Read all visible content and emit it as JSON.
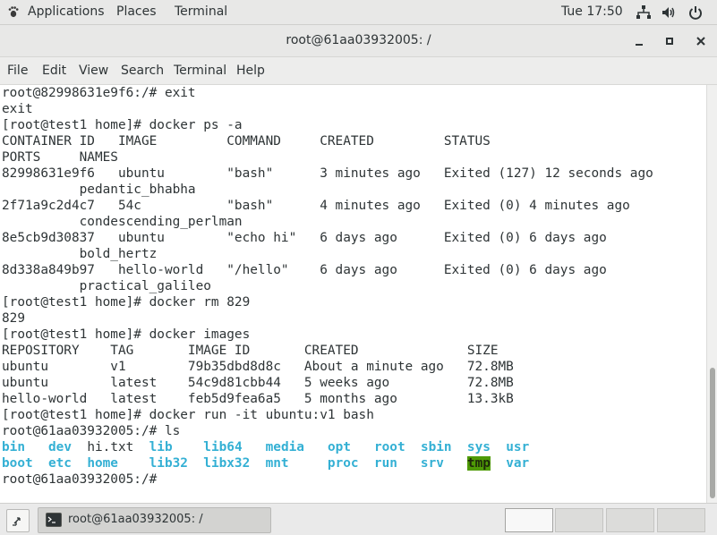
{
  "top_bar": {
    "applications_label": "Applications",
    "places_label": "Places",
    "terminal_label": "Terminal",
    "clock": "Tue 17:50"
  },
  "window": {
    "title": "root@61aa03932005: /",
    "menu": [
      "File",
      "Edit",
      "View",
      "Search",
      "Terminal",
      "Help"
    ]
  },
  "terminal": {
    "lines": [
      "root@82998631e9f6:/# exit",
      "exit",
      "[root@test1 home]# docker ps -a",
      "CONTAINER ID   IMAGE         COMMAND     CREATED         STATUS",
      "PORTS     NAMES",
      "82998631e9f6   ubuntu        \"bash\"      3 minutes ago   Exited (127) 12 seconds ago",
      "          pedantic_bhabha",
      "2f71a9c2d4c7   54c           \"bash\"      4 minutes ago   Exited (0) 4 minutes ago",
      "          condescending_perlman",
      "8e5cb9d30837   ubuntu        \"echo hi\"   6 days ago      Exited (0) 6 days ago",
      "          bold_hertz",
      "8d338a849b97   hello-world   \"/hello\"    6 days ago      Exited (0) 6 days ago",
      "          practical_galileo",
      "[root@test1 home]# docker rm 829",
      "829",
      "[root@test1 home]# docker images",
      "REPOSITORY    TAG       IMAGE ID       CREATED              SIZE",
      "ubuntu        v1        79b35dbd8d8c   About a minute ago   72.8MB",
      "ubuntu        latest    54c9d81cbb44   5 weeks ago          72.8MB",
      "hello-world   latest    feb5d9fea6a5   5 months ago         13.3kB",
      "[root@test1 home]# docker run -it ubuntu:v1 bash",
      "root@61aa03932005:/# ls"
    ],
    "ls_row1": [
      {
        "t": "bin",
        "s": "dir"
      },
      {
        "t": "   ",
        "s": ""
      },
      {
        "t": "dev",
        "s": "dir"
      },
      {
        "t": "  ",
        "s": ""
      },
      {
        "t": "hi.txt",
        "s": ""
      },
      {
        "t": "  ",
        "s": ""
      },
      {
        "t": "lib",
        "s": "dir"
      },
      {
        "t": "    ",
        "s": ""
      },
      {
        "t": "lib64",
        "s": "dir"
      },
      {
        "t": "   ",
        "s": ""
      },
      {
        "t": "media",
        "s": "dir"
      },
      {
        "t": "   ",
        "s": ""
      },
      {
        "t": "opt",
        "s": "dir"
      },
      {
        "t": "   ",
        "s": ""
      },
      {
        "t": "root",
        "s": "dir"
      },
      {
        "t": "  ",
        "s": ""
      },
      {
        "t": "sbin",
        "s": "dir"
      },
      {
        "t": "  ",
        "s": ""
      },
      {
        "t": "sys",
        "s": "dir"
      },
      {
        "t": "  ",
        "s": ""
      },
      {
        "t": "usr",
        "s": "dir"
      }
    ],
    "ls_row2": [
      {
        "t": "boot",
        "s": "dir"
      },
      {
        "t": "  ",
        "s": ""
      },
      {
        "t": "etc",
        "s": "dir"
      },
      {
        "t": "  ",
        "s": ""
      },
      {
        "t": "home",
        "s": "dir"
      },
      {
        "t": "    ",
        "s": ""
      },
      {
        "t": "lib32",
        "s": "dir"
      },
      {
        "t": "  ",
        "s": ""
      },
      {
        "t": "libx32",
        "s": "dir"
      },
      {
        "t": "  ",
        "s": ""
      },
      {
        "t": "mnt",
        "s": "dir"
      },
      {
        "t": "     ",
        "s": ""
      },
      {
        "t": "proc",
        "s": "dir"
      },
      {
        "t": "  ",
        "s": ""
      },
      {
        "t": "run",
        "s": "dir"
      },
      {
        "t": "   ",
        "s": ""
      },
      {
        "t": "srv",
        "s": "dir"
      },
      {
        "t": "   ",
        "s": ""
      },
      {
        "t": "tmp",
        "s": "dir-hl"
      },
      {
        "t": "  ",
        "s": ""
      },
      {
        "t": "var",
        "s": "dir"
      }
    ],
    "last_prompt": "root@61aa03932005:/# "
  },
  "taskbar": {
    "task_label": "root@61aa03932005: /"
  },
  "colors": {
    "directory": "#34b0d4",
    "highlight_bg": "#4e9a06"
  },
  "icons": {
    "applications": "gnome-foot-icon",
    "network": "network-icon",
    "volume": "volume-icon",
    "power": "power-icon",
    "minimize": "minimize-icon",
    "maximize": "maximize-icon",
    "close": "close-icon"
  }
}
